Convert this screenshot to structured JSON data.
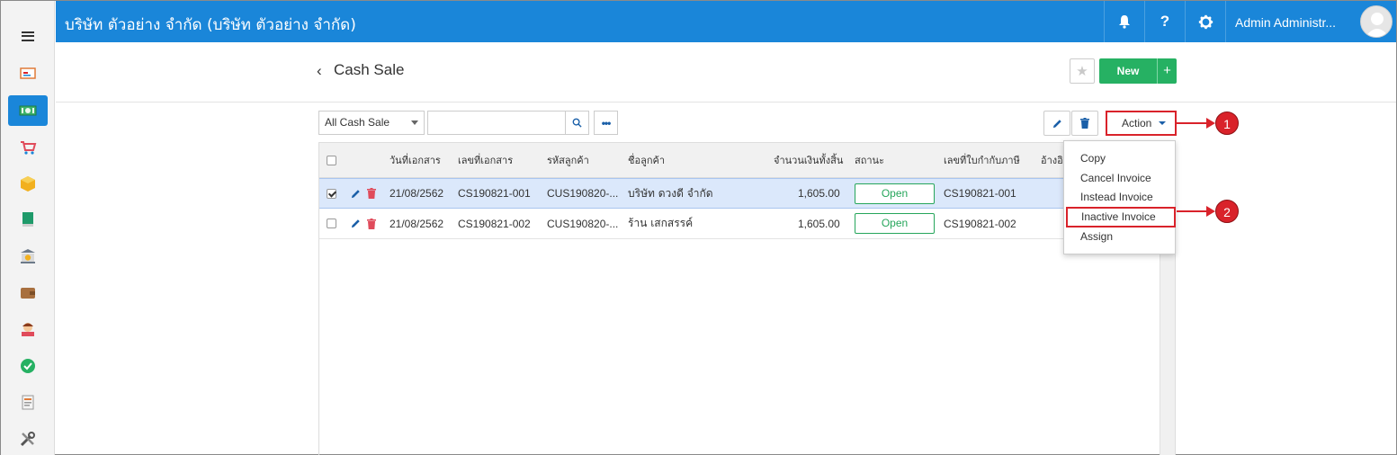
{
  "topbar": {
    "company": "บริษัท ตัวอย่าง จำกัด (บริษัท ตัวอย่าง จำกัด)",
    "help_label": "?",
    "user_name": "Admin Administr..."
  },
  "sidebar": {
    "items": [
      "dashboard-icon",
      "cash-icon",
      "cart-icon",
      "box-icon",
      "book-icon",
      "bank-icon",
      "wallet-icon",
      "person-icon",
      "check-circle-icon",
      "report-icon",
      "tools-icon"
    ],
    "active_index": 1
  },
  "header": {
    "title": "Cash Sale",
    "new_label": "New",
    "new_plus": "+"
  },
  "toolbar": {
    "filter_value": "All Cash Sale",
    "search_placeholder": "",
    "more_label": "•••",
    "action_label": "Action"
  },
  "table": {
    "headers": {
      "date": "วันที่เอกสาร",
      "doc_no": "เลขที่เอกสาร",
      "cust_code": "รหัสลูกค้า",
      "cust_name": "ชื่อลูกค้า",
      "amount": "จำนวนเงินทั้งสิ้น",
      "status": "สถานะ",
      "tax_no": "เลขที่ใบกำกับภาษี",
      "ref": "อ้างอิ"
    },
    "rows": [
      {
        "selected": true,
        "date": "21/08/2562",
        "doc_no": "CS190821-001",
        "cust_code": "CUS190820-...",
        "cust_name": "บริษัท ดวงดี จำกัด",
        "amount": "1,605.00",
        "status": "Open",
        "tax_no": "CS190821-001"
      },
      {
        "selected": false,
        "date": "21/08/2562",
        "doc_no": "CS190821-002",
        "cust_code": "CUS190820-...",
        "cust_name": "ร้าน เสกสรรค์",
        "amount": "1,605.00",
        "status": "Open",
        "tax_no": "CS190821-002"
      }
    ]
  },
  "action_menu": {
    "items": [
      "Copy",
      "Cancel Invoice",
      "Instead Invoice",
      "Inactive Invoice",
      "Assign"
    ],
    "highlighted_index": 3
  },
  "callouts": [
    "1",
    "2"
  ],
  "colors": {
    "primary": "#1a86d9",
    "success": "#26b163",
    "danger": "#d9222a",
    "row_selected": "#dbe8fb"
  }
}
